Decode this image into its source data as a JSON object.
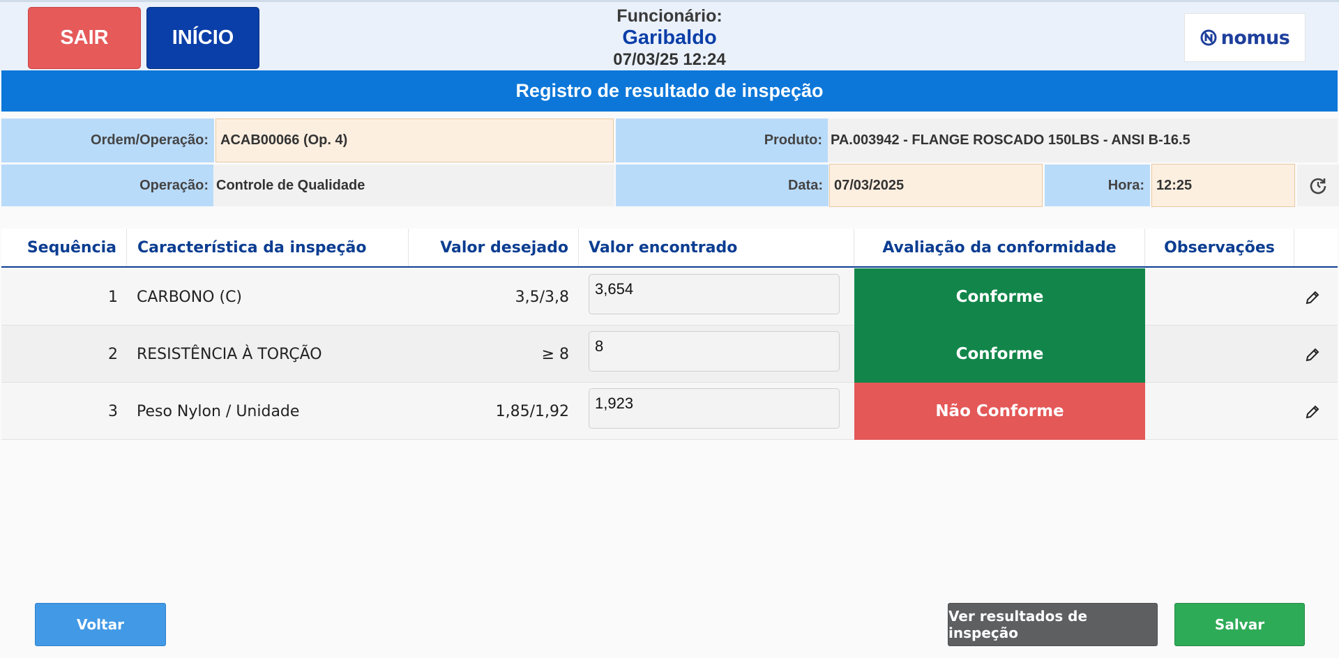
{
  "header": {
    "exit_label": "SAIR",
    "home_label": "INÍCIO",
    "employee_label": "Funcionário:",
    "employee_name": "Garibaldo",
    "datetime": "07/03/25 12:24",
    "logo_text": "nomus"
  },
  "page_title": "Registro de resultado de inspeção",
  "info": {
    "order_label": "Ordem/Operação:",
    "order_value": "ACAB00066 (Op. 4)",
    "product_label": "Produto:",
    "product_value": "PA.003942 - FLANGE ROSCADO 150LBS - ANSI B-16.5",
    "operation_label": "Operação:",
    "operation_value": "Controle de Qualidade",
    "date_label": "Data:",
    "date_value": "07/03/2025",
    "time_label": "Hora:",
    "time_value": "12:25"
  },
  "table": {
    "headers": {
      "seq": "Sequência",
      "characteristic": "Característica da inspeção",
      "desired": "Valor desejado",
      "found": "Valor encontrado",
      "conformity": "Avaliação da conformidade",
      "notes": "Observações"
    },
    "rows": [
      {
        "seq": "1",
        "characteristic": "CARBONO (C)",
        "desired": "3,5/3,8",
        "found": "3,654",
        "conformity": "Conforme",
        "color": "#12864a"
      },
      {
        "seq": "2",
        "characteristic": "RESISTÊNCIA À TORÇÃO",
        "desired": "≥ 8",
        "found": "8",
        "conformity": "Conforme",
        "color": "#12864a"
      },
      {
        "seq": "3",
        "characteristic": "Peso Nylon / Unidade",
        "desired": "1,85/1,92",
        "found": "1,923",
        "conformity": "Não Conforme",
        "color": "#e45858"
      }
    ]
  },
  "footer": {
    "back_label": "Voltar",
    "view_results_label": "Ver resultados de inspeção",
    "save_label": "Salvar"
  },
  "colors": {
    "primary": "#0c77d9",
    "dark_blue": "#0a3ea8",
    "danger": "#e65a5a",
    "success": "#12864a",
    "save": "#2eab57"
  }
}
